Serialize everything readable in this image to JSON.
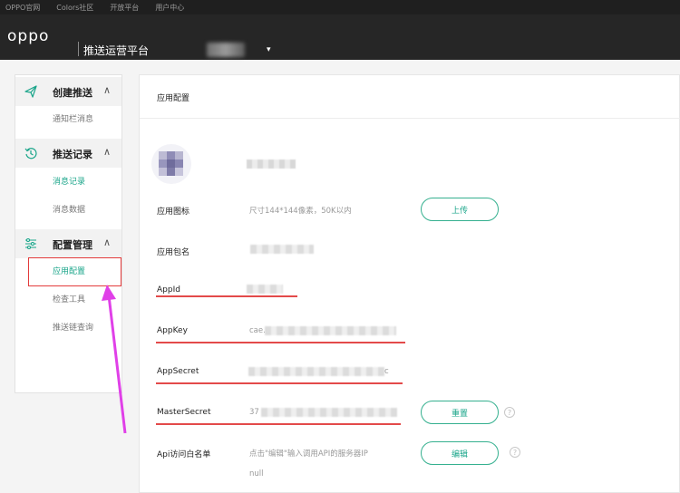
{
  "topnav": {
    "links": [
      "OPPO官网",
      "Colors社区",
      "开放平台",
      "用户中心"
    ]
  },
  "header": {
    "logo": "oppo",
    "title": "推送运营平台",
    "caret": "▾"
  },
  "sidebar": {
    "sections": [
      {
        "label": "创建推送",
        "icon": "paper-plane-icon",
        "items": [
          {
            "label": "通知栏消息",
            "active": false
          }
        ]
      },
      {
        "label": "推送记录",
        "icon": "history-icon",
        "items": [
          {
            "label": "消息记录",
            "active": true
          },
          {
            "label": "消息数据",
            "active": false
          }
        ]
      },
      {
        "label": "配置管理",
        "icon": "sliders-icon",
        "items": [
          {
            "label": "应用配置",
            "active": true
          },
          {
            "label": "检查工具",
            "active": false
          },
          {
            "label": "推送链查询",
            "active": false
          }
        ]
      }
    ],
    "chevron": "∧"
  },
  "main": {
    "title": "应用配置",
    "rows": {
      "icon": {
        "label": "应用图标",
        "hint": "尺寸144*144像素，50K以内",
        "button": "上传"
      },
      "package": {
        "label": "应用包名"
      },
      "appid": {
        "label": "AppId"
      },
      "appkey": {
        "label": "AppKey",
        "prefix": "cae."
      },
      "appsecret": {
        "label": "AppSecret",
        "suffix": "c"
      },
      "mastersecret": {
        "label": "MasterSecret",
        "prefix": "37",
        "button": "重置"
      },
      "whitelist": {
        "label": "Api访问白名单",
        "hint": "点击\"编辑\"输入调用API的服务器IP",
        "value": "null",
        "button": "编辑"
      }
    },
    "help_glyph": "?"
  },
  "colors": {
    "accent": "#1aa58a",
    "annotation_red": "#e34a4a",
    "annotation_arrow": "#e040e8",
    "header_bg": "#262626"
  }
}
